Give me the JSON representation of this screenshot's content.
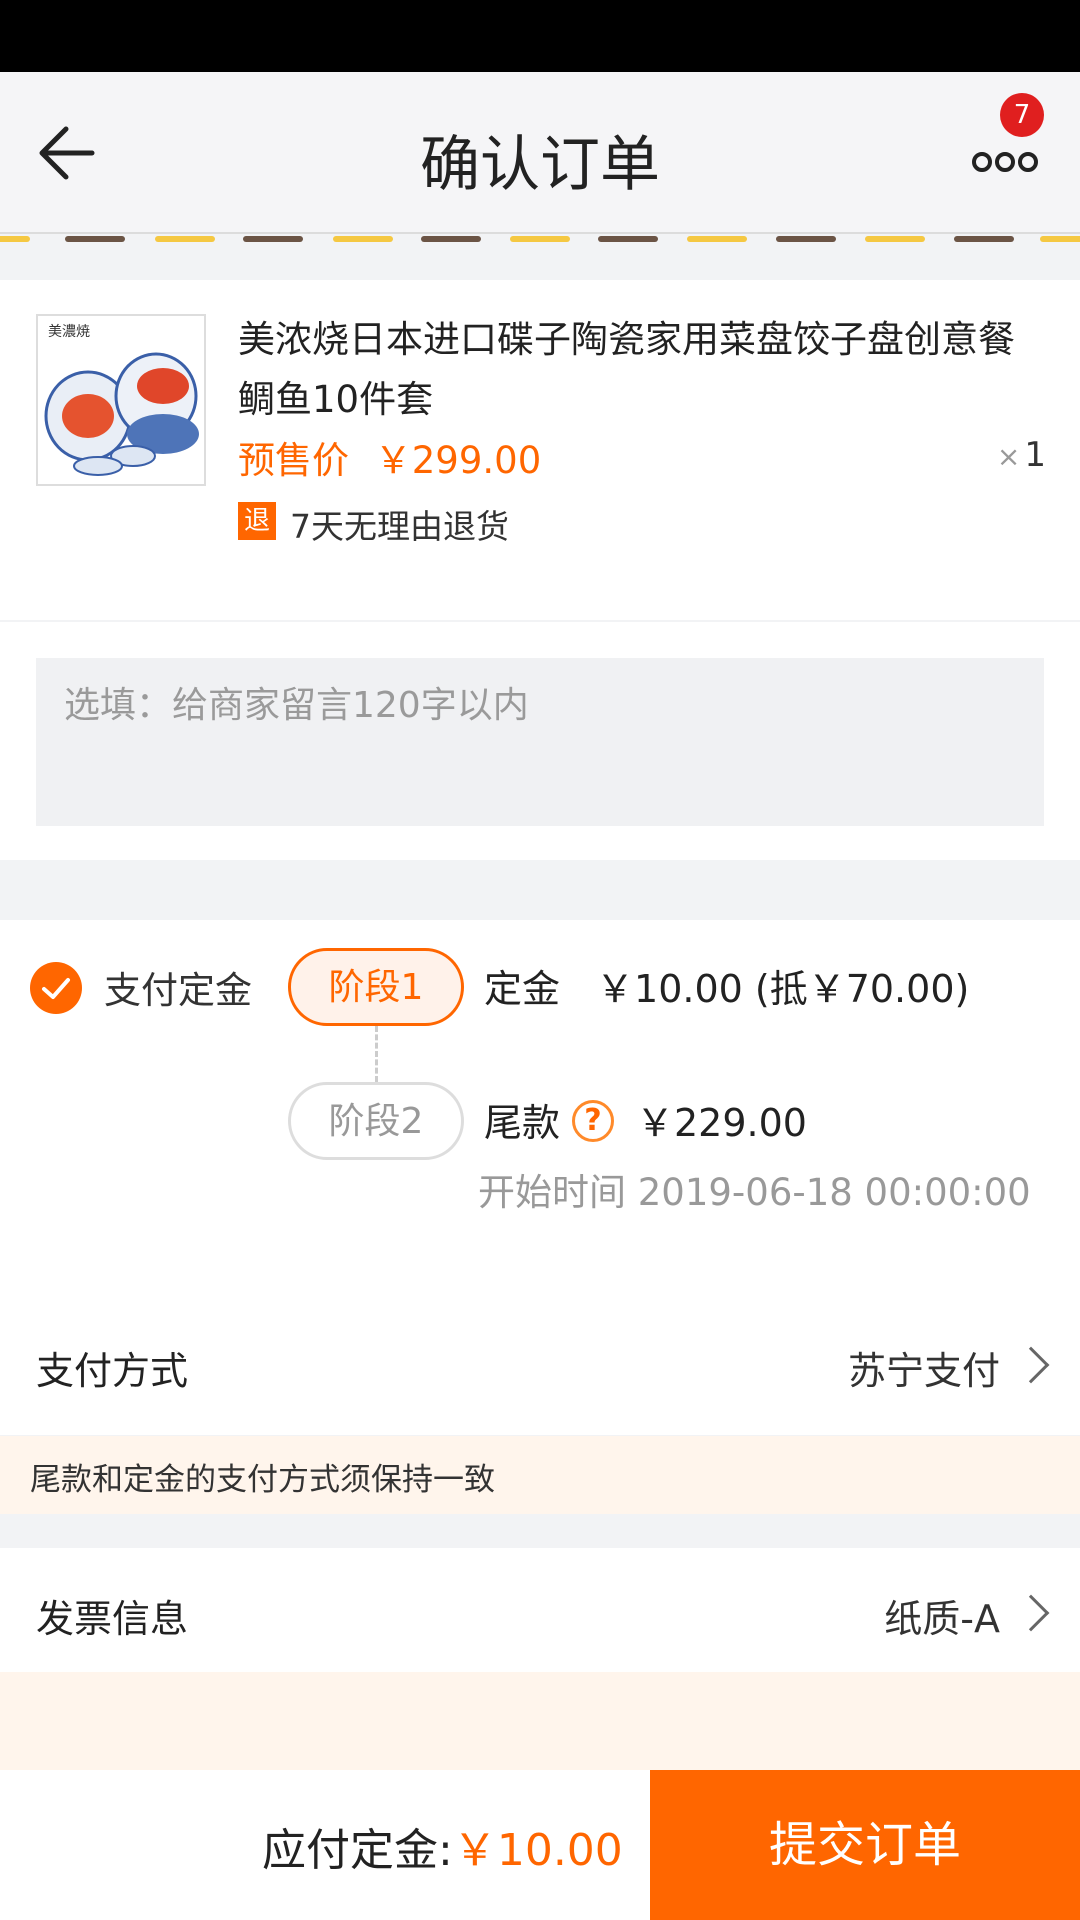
{
  "header": {
    "title": "确认订单",
    "notification_count": "7"
  },
  "product": {
    "name": "美浓烧日本进口碟子陶瓷家用菜盘饺子盘创意餐鲷鱼10件套",
    "presale_label": "预售价",
    "price": "￥299.00",
    "qty_symbol": "×",
    "quantity": "1",
    "refund_badge": "退",
    "refund_text": "7天无理由退货",
    "thumb_caption": "美濃焼"
  },
  "memo": {
    "placeholder": "选填：给商家留言120字以内"
  },
  "payment_stages": {
    "deposit_option_label": "支付定金",
    "stage1_label": "阶段1",
    "stage1_type": "定金",
    "stage1_amount": "￥10.00 (抵￥70.00)",
    "stage2_label": "阶段2",
    "stage2_type": "尾款",
    "stage2_help": "?",
    "stage2_amount": "￥229.00",
    "start_time": "开始时间 2019-06-18 00:00:00"
  },
  "pay_method": {
    "label": "支付方式",
    "value": "苏宁支付"
  },
  "notice": "尾款和定金的支付方式须保持一致",
  "invoice": {
    "label": "发票信息",
    "value": "纸质-A"
  },
  "footer": {
    "due_label": "应付定金:",
    "due_amount": "￥10.00",
    "submit_label": "提交订单"
  },
  "colors": {
    "accent": "#ff6600",
    "badge": "#e01f1f",
    "notice_bg": "#fff5ec"
  },
  "icons": [
    "back-arrow-icon",
    "more-dots-icon",
    "check-icon",
    "question-icon",
    "chevron-right-icon"
  ]
}
